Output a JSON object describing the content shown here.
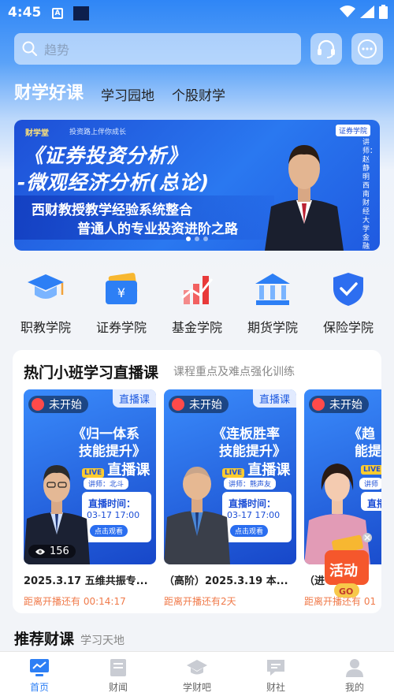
{
  "statusbar": {
    "time": "4:45"
  },
  "search": {
    "placeholder": "趋势"
  },
  "tabs": [
    {
      "label": "财学好课",
      "active": true
    },
    {
      "label": "学习园地",
      "active": false
    },
    {
      "label": "个股财学",
      "active": false
    }
  ],
  "banner": {
    "brand": "财学堂",
    "slogan": "投资路上伴你成长",
    "tag": "证券学院",
    "title1": "《证券投资分析》",
    "title2": "-微观经济分析(总论)",
    "sub1": "西财教授教学经验系统整合",
    "sub2": "普通人的专业投资进阶之路",
    "lecturer": "讲师：赵静明 西南财经大学金融学院教授"
  },
  "categories": [
    {
      "label": "职教学院",
      "icon": "graduation-cap-icon"
    },
    {
      "label": "证券学院",
      "icon": "yen-card-icon"
    },
    {
      "label": "基金学院",
      "icon": "chart-up-icon"
    },
    {
      "label": "期货学院",
      "icon": "bank-building-icon"
    },
    {
      "label": "保险学院",
      "icon": "shield-check-icon"
    }
  ],
  "live_section": {
    "title": "热门小班学习直播课",
    "subtitle": "课程重点及难点强化训练",
    "cards": [
      {
        "status": "未开始",
        "type": "直播课",
        "poster_title1": "《归一体系",
        "poster_title2": "技能提升》",
        "poster_live": "直播课",
        "live_badge": "LIVE",
        "speaker": "讲师：北斗",
        "time_label": "直播时间：",
        "time": "03-17 17:00",
        "cta": "点击观看",
        "views": "156",
        "title": "2025.3.17 五维共振专...",
        "countdown": "距离开播还有 00:14:17"
      },
      {
        "status": "未开始",
        "type": "直播课",
        "poster_title1": "《连板胜率",
        "poster_title2": "技能提升》",
        "poster_live": "直播课",
        "live_badge": "LIVE",
        "speaker": "讲师：熊声友",
        "time_label": "直播时间：",
        "time": "03-17 17:00",
        "cta": "点击观看",
        "views": "",
        "title": "（高阶）2025.3.19 本...",
        "countdown": "距离开播还有2天"
      },
      {
        "status": "未开始",
        "type": "直播课",
        "poster_title1": "《趋",
        "poster_title2": "能提",
        "poster_live": "",
        "live_badge": "LIVE",
        "speaker": "讲师",
        "time_label": "直播",
        "time": "",
        "cta": "",
        "views": "",
        "title": "（进",
        "countdown": "距离开播还有 01"
      }
    ]
  },
  "activity": {
    "label": "活动",
    "go": "GO"
  },
  "recommend": {
    "title": "推荐财课",
    "subtitle": "学习天地"
  },
  "nav": [
    {
      "label": "首页",
      "icon": "home-chart-icon",
      "active": true
    },
    {
      "label": "财闻",
      "icon": "news-icon",
      "active": false
    },
    {
      "label": "学财吧",
      "icon": "graduation-icon",
      "active": false
    },
    {
      "label": "财社",
      "icon": "chat-icon",
      "active": false
    },
    {
      "label": "我的",
      "icon": "user-icon",
      "active": false
    }
  ],
  "colors": {
    "primary": "#2d7ff5",
    "accent": "#f07a4a",
    "tab_highlight": "#f7c246"
  }
}
